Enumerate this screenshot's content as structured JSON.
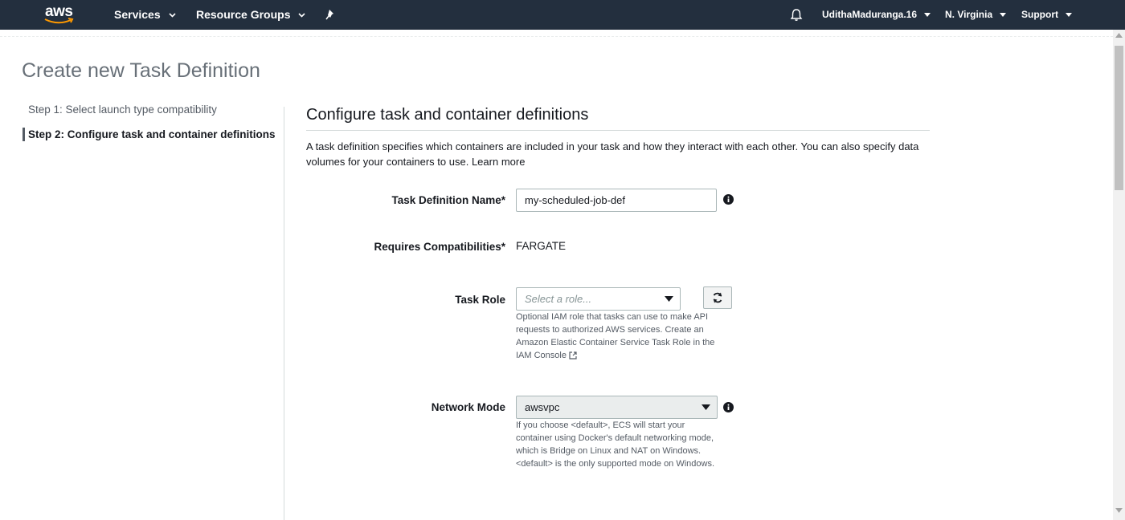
{
  "nav": {
    "logo": "aws",
    "services": "Services",
    "resource_groups": "Resource Groups",
    "user": "UdithaMaduranga.16",
    "region": "N. Virginia",
    "support": "Support",
    "icons": [
      "chevron-down-icon",
      "pin-icon",
      "bell-icon"
    ],
    "background": "#232f3e"
  },
  "page": {
    "title": "Create new Task Definition"
  },
  "steps": [
    {
      "label": "Step 1: Select launch type compatibility",
      "active": false
    },
    {
      "label": "Step 2: Configure task and container definitions",
      "active": true
    }
  ],
  "section": {
    "title": "Configure task and container definitions",
    "description": "A task definition specifies which containers are included in your task and how they interact with each other. You can also specify data volumes for your containers to use.",
    "learn_more": "Learn more"
  },
  "form": {
    "task_def_name": {
      "label": "Task Definition Name*",
      "value": "my-scheduled-job-def"
    },
    "requires_compat": {
      "label": "Requires Compatibilities*",
      "value": "FARGATE"
    },
    "task_role": {
      "label": "Task Role",
      "placeholder": "Select a role...",
      "help": "Optional IAM role that tasks can use to make API requests to authorized AWS services. Create an Amazon Elastic Container Service Task Role in the",
      "help_link": "IAM Console"
    },
    "network_mode": {
      "label": "Network Mode",
      "value": "awsvpc",
      "help": "If you choose <default>, ECS will start your container using Docker's default networking mode, which is Bridge on Linux and NAT on Windows. <default> is the only supported mode on Windows."
    }
  }
}
